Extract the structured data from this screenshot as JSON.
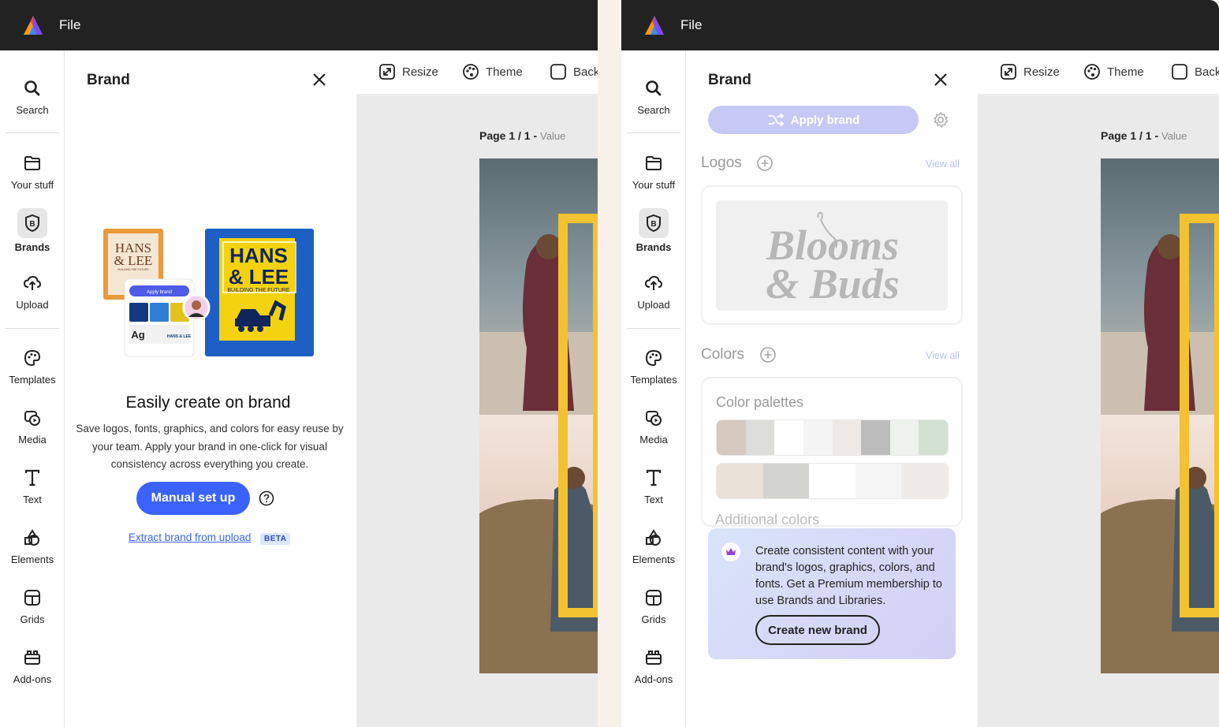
{
  "app": {
    "file_menu": "File"
  },
  "nav": {
    "items": [
      {
        "label": "Search",
        "icon": "search-icon"
      },
      {
        "label": "Your stuff",
        "icon": "folder-icon"
      },
      {
        "label": "Brands",
        "icon": "brand-icon"
      },
      {
        "label": "Upload",
        "icon": "upload-icon"
      },
      {
        "label": "Templates",
        "icon": "templates-icon"
      },
      {
        "label": "Media",
        "icon": "media-icon"
      },
      {
        "label": "Text",
        "icon": "text-icon"
      },
      {
        "label": "Elements",
        "icon": "elements-icon"
      },
      {
        "label": "Grids",
        "icon": "grids-icon"
      },
      {
        "label": "Add-ons",
        "icon": "addons-icon"
      }
    ]
  },
  "toolbar": {
    "resize": "Resize",
    "theme": "Theme",
    "background": "Back"
  },
  "canvas": {
    "page_label": "Page 1 / 1 -",
    "page_value": "Value"
  },
  "left_panel": {
    "title": "Brand",
    "illustration": {
      "card_a_line1": "HANS",
      "card_a_line2": "& LEE",
      "card_a_tagline": "BUILDING THE FUTURE",
      "card_b_line1": "HANS",
      "card_b_line2": "& LEE",
      "card_b_tagline": "BUILDING THE FUTURE",
      "mini_apply_brand": "Apply brand",
      "mini_font": "Ag",
      "mini_logo": "HANS & LEE",
      "swatches": [
        "#123a80",
        "#2f7fd6",
        "#e3c31b"
      ]
    },
    "empty_title": "Easily create on brand",
    "empty_desc": "Save logos, fonts, graphics, and colors for easy reuse by your team. Apply your brand in one-click for visual consistency across everything you create.",
    "manual_setup": "Manual set up",
    "extract_link": "Extract brand from upload",
    "beta": "BETA"
  },
  "right_panel": {
    "title": "Brand",
    "apply_brand": "Apply brand",
    "logos_heading": "Logos",
    "logos_view_all": "View all",
    "logo_text_line1": "Blooms",
    "logo_text_line2": "& Buds",
    "colors_heading": "Colors",
    "colors_view_all": "View all",
    "palettes_heading": "Color palettes",
    "palette_1": [
      "#d6c9c0",
      "#dcdcd8",
      "#ffffff",
      "#f4f4f4",
      "#efeae6",
      "#bcbcbc",
      "#eef2ec",
      "#d3e1d3"
    ],
    "palette_2": [
      "#eae1d8",
      "#d3d3cf",
      "#ffffff",
      "#f5f5f5",
      "#efebe8"
    ],
    "additional_colors": "Additional colors",
    "promo_text": "Create consistent content with your brand's logos, graphics, colors, and fonts. Get a Premium membership to use Brands and Libraries.",
    "create_new_brand": "Create new brand"
  },
  "colors": {
    "accent": "#3b63fb",
    "topbar": "#222222",
    "brand_yellow": "#f2c230"
  }
}
